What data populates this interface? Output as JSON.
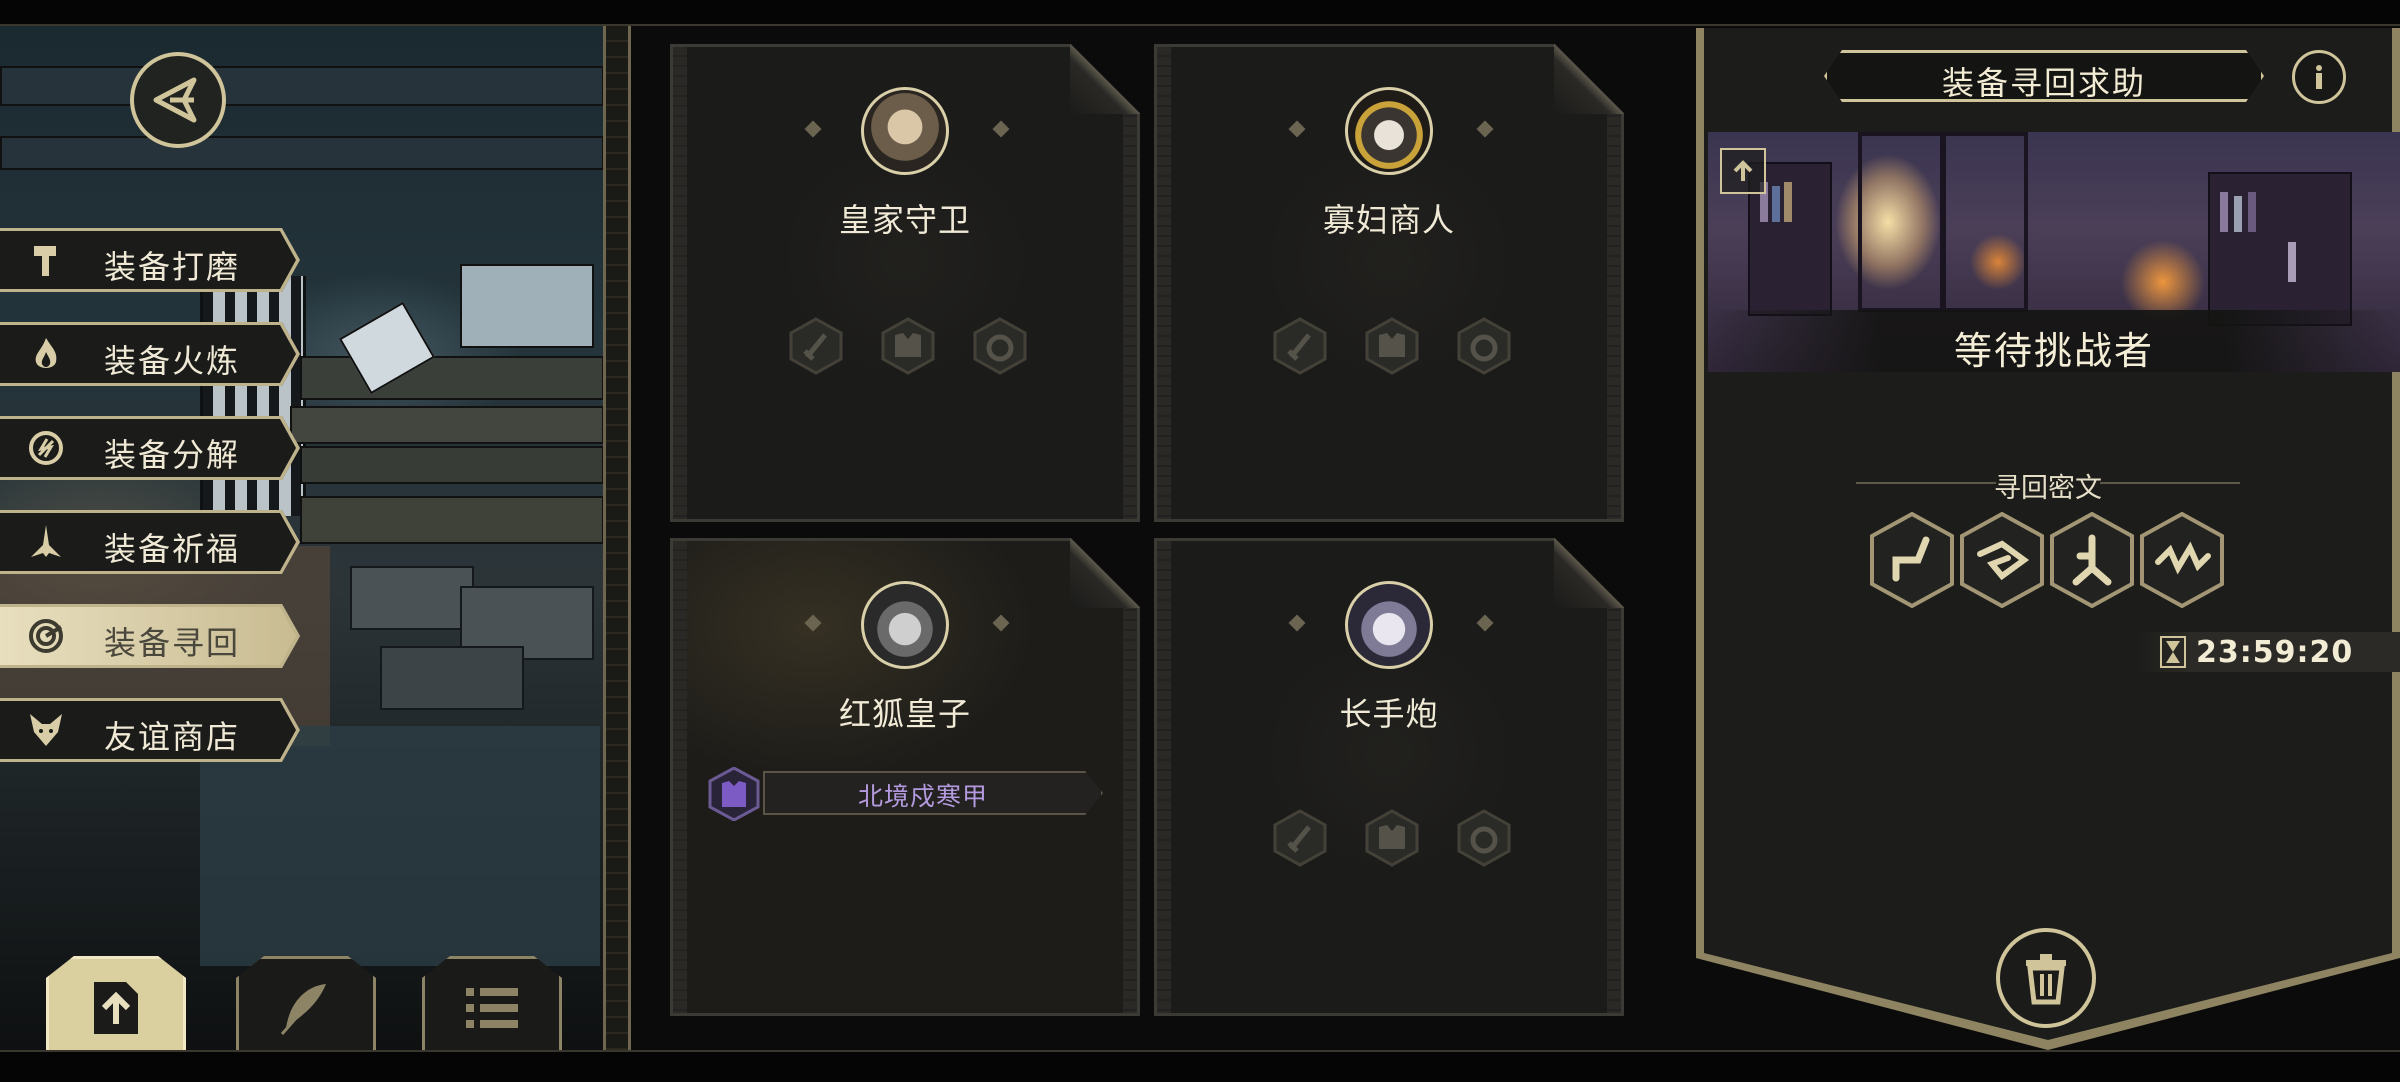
{
  "menu": {
    "items": [
      {
        "label": "装备打磨",
        "icon": "hammer-icon",
        "active": false
      },
      {
        "label": "装备火炼",
        "icon": "flame-icon",
        "active": false
      },
      {
        "label": "装备分解",
        "icon": "decompose-icon",
        "active": false
      },
      {
        "label": "装备祈福",
        "icon": "pray-hands-icon",
        "active": false
      },
      {
        "label": "装备寻回",
        "icon": "spiral-target-icon",
        "active": true
      },
      {
        "label": "友谊商店",
        "icon": "fox-head-icon",
        "active": false
      }
    ]
  },
  "bottom_tabs": [
    {
      "icon": "upload-doc-icon",
      "active": true
    },
    {
      "icon": "feather-icon",
      "active": false
    },
    {
      "icon": "list-icon",
      "active": false
    }
  ],
  "cards": [
    {
      "name": "皇家守卫",
      "portrait": "royal-guard-portrait",
      "equipped_item": null
    },
    {
      "name": "寡妇商人",
      "portrait": "widow-merchant-portrait",
      "equipped_item": null
    },
    {
      "name": "红狐皇子",
      "portrait": "red-fox-prince-portrait",
      "equipped_item": "北境戍寒甲"
    },
    {
      "name": "长手炮",
      "portrait": "long-cannon-portrait",
      "equipped_item": null
    }
  ],
  "panel": {
    "title": "装备寻回求助",
    "banner_caption": "等待挑战者",
    "runes_title": "寻回密文",
    "timer": "23:59:20"
  },
  "colors": {
    "accent": "#cfc49a",
    "item_text": "#b49be0",
    "item_icon": "#7c5cc4"
  }
}
